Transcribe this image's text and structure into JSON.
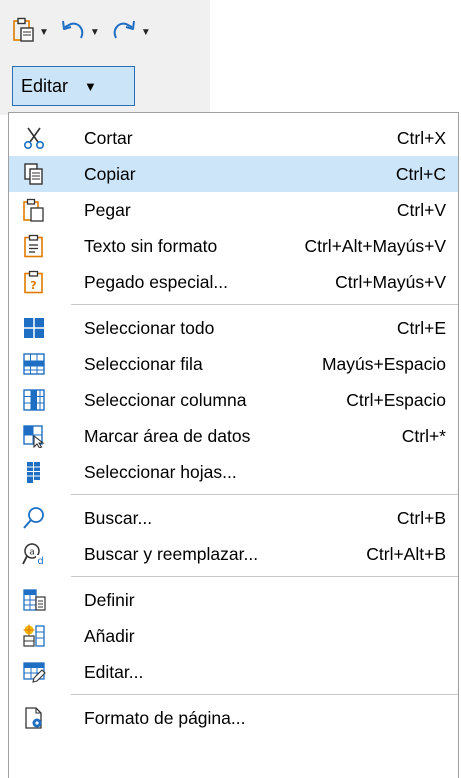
{
  "toolbar": {
    "icons": [
      "paste-icon",
      "undo-icon",
      "redo-icon"
    ]
  },
  "edit_menu_button": {
    "label": "Editar",
    "caret": "▼"
  },
  "menu": {
    "items": [
      {
        "label": "Cortar",
        "shortcut": "Ctrl+X",
        "icon": "scissors-icon"
      },
      {
        "label": "Copiar",
        "shortcut": "Ctrl+C",
        "icon": "copy-icon",
        "highlighted": true
      },
      {
        "label": "Pegar",
        "shortcut": "Ctrl+V",
        "icon": "paste-icon"
      },
      {
        "label": "Texto sin formato",
        "shortcut": "Ctrl+Alt+Mayús+V",
        "icon": "paste-unformatted-icon"
      },
      {
        "label": "Pegado especial...",
        "shortcut": "Ctrl+Mayús+V",
        "icon": "paste-special-icon"
      },
      {
        "label": "Seleccionar todo",
        "shortcut": "Ctrl+E",
        "icon": "select-all-icon"
      },
      {
        "label": "Seleccionar fila",
        "shortcut": "Mayús+Espacio",
        "icon": "select-row-icon"
      },
      {
        "label": "Seleccionar columna",
        "shortcut": "Ctrl+Espacio",
        "icon": "select-column-icon"
      },
      {
        "label": "Marcar área de datos",
        "shortcut": "Ctrl+*",
        "icon": "select-data-area-icon"
      },
      {
        "label": "Seleccionar hojas...",
        "shortcut": "",
        "icon": "select-sheets-icon"
      },
      {
        "label": "Buscar...",
        "shortcut": "Ctrl+B",
        "icon": "search-icon"
      },
      {
        "label": "Buscar y reemplazar...",
        "shortcut": "Ctrl+Alt+B",
        "icon": "find-replace-icon"
      },
      {
        "label": "Definir",
        "shortcut": "",
        "icon": "define-range-icon"
      },
      {
        "label": "Añadir",
        "shortcut": "",
        "icon": "add-range-icon"
      },
      {
        "label": "Editar...",
        "shortcut": "",
        "icon": "edit-range-icon"
      },
      {
        "label": "Formato de página...",
        "shortcut": "",
        "icon": "page-format-icon"
      }
    ]
  },
  "colors": {
    "highlight": "#cde5f8",
    "dropdown_bg": "#cce4f7",
    "dropdown_border": "#2a6fb5",
    "icon_blue": "#1e6fc4",
    "icon_orange": "#e07b00"
  }
}
